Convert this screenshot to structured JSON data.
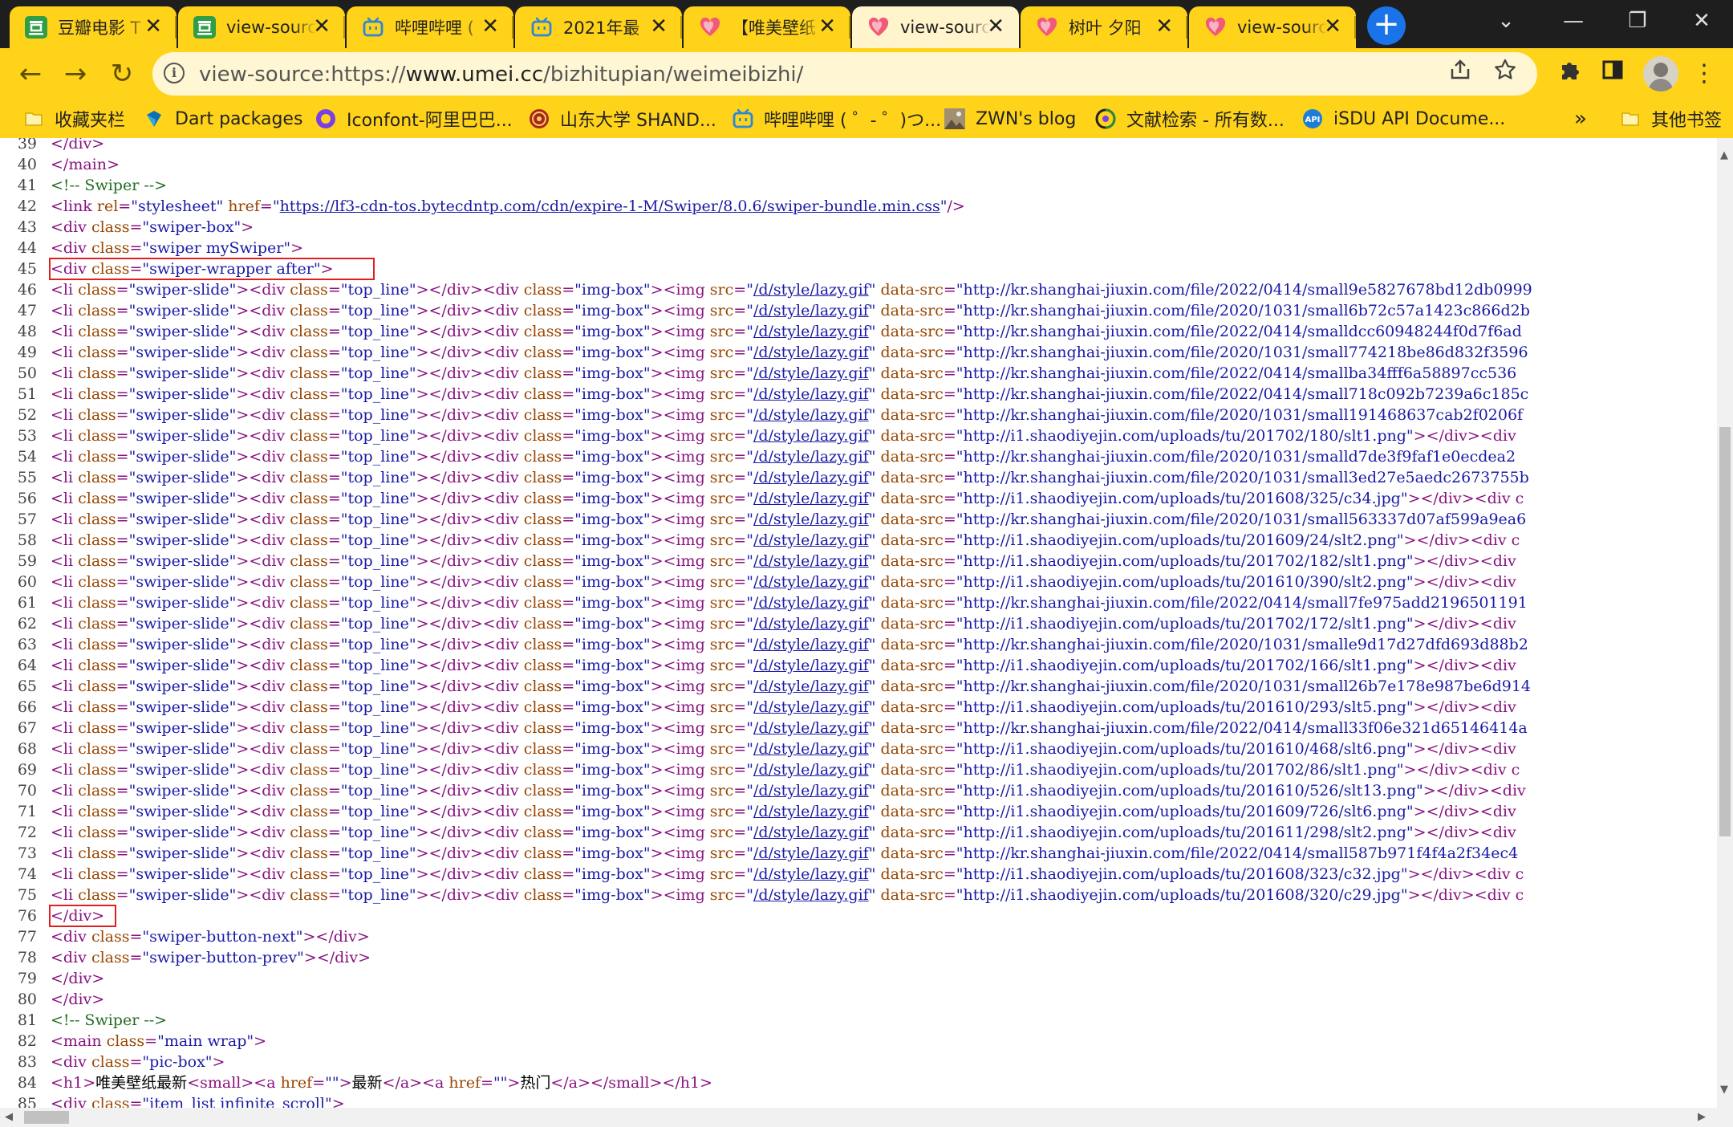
{
  "tabs": [
    {
      "title": "豆瓣电影 T",
      "icon": "douban-icon",
      "active": false
    },
    {
      "title": "view-source",
      "icon": "douban-icon",
      "active": false
    },
    {
      "title": "哔哩哔哩 (",
      "icon": "bilibili-icon",
      "active": false
    },
    {
      "title": "2021年最",
      "icon": "bilibili-icon",
      "active": false
    },
    {
      "title": "【唯美壁纸",
      "icon": "heart-icon",
      "active": false
    },
    {
      "title": "view-source",
      "icon": "heart-icon",
      "active": true
    },
    {
      "title": "树叶 夕阳",
      "icon": "heart-icon",
      "active": false
    },
    {
      "title": "view-source",
      "icon": "heart-icon",
      "active": false
    }
  ],
  "tab_close_glyph": "✕",
  "new_tab_glyph": "+",
  "window_controls": {
    "dropdown": "⌄",
    "minimize": "—",
    "restore": "❐",
    "close": "✕"
  },
  "toolbar": {
    "back": "←",
    "forward": "→",
    "reload": "↻"
  },
  "address": {
    "scheme": "view-source:https://",
    "host": "www.umei.cc",
    "path": "/bizhitupian/weimeibizhi/"
  },
  "bookmarks": [
    {
      "label": "收藏夹栏",
      "icon": "folder-icon"
    },
    {
      "label": "Dart packages",
      "icon": "dart-icon"
    },
    {
      "label": "Iconfont-阿里巴巴...",
      "icon": "iconfont-icon"
    },
    {
      "label": "山东大学 SHAND...",
      "icon": "sdu-icon"
    },
    {
      "label": "哔哩哔哩 ( ゜- ゜)つ...",
      "icon": "bilibili-icon"
    },
    {
      "label": "ZWN's blog",
      "icon": "blog-icon"
    },
    {
      "label": "文献检索 - 所有数...",
      "icon": "literature-icon"
    },
    {
      "label": "iSDU API Docume...",
      "icon": "api-icon"
    }
  ],
  "bookmarks_overflow": "»",
  "other_bookmarks": "其他书签",
  "source_lines": [
    {
      "n": "39",
      "text": "</div>"
    },
    {
      "n": "40",
      "text": "</main>"
    },
    {
      "n": "41",
      "text": "<!-- Swiper -->"
    },
    {
      "n": "42",
      "text": "<link rel=\"stylesheet\" href=\"https://lf3-cdn-tos.bytecdntp.com/cdn/expire-1-M/Swiper/8.0.6/swiper-bundle.min.css\"/>"
    },
    {
      "n": "43",
      "text": "<div class=\"swiper-box\">"
    },
    {
      "n": "44",
      "text": "<div class=\"swiper mySwiper\">"
    },
    {
      "n": "45",
      "text": "<div class=\"swiper-wrapper after\">"
    },
    {
      "n": "46",
      "text": "<li class=\"swiper-slide\"><div class=\"top_line\"></div><div class=\"img-box\"><img src=\"/d/style/lazy.gif\" data-src=\"http://kr.shanghai-jiuxin.com/file/2022/0414/small9e5827678bd12db0999"
    },
    {
      "n": "47",
      "text": "<li class=\"swiper-slide\"><div class=\"top_line\"></div><div class=\"img-box\"><img src=\"/d/style/lazy.gif\" data-src=\"http://kr.shanghai-jiuxin.com/file/2020/1031/small6b72c57a1423c866d2b"
    },
    {
      "n": "48",
      "text": "<li class=\"swiper-slide\"><div class=\"top_line\"></div><div class=\"img-box\"><img src=\"/d/style/lazy.gif\" data-src=\"http://kr.shanghai-jiuxin.com/file/2022/0414/smalldcc60948244f0d7f6ad"
    },
    {
      "n": "49",
      "text": "<li class=\"swiper-slide\"><div class=\"top_line\"></div><div class=\"img-box\"><img src=\"/d/style/lazy.gif\" data-src=\"http://kr.shanghai-jiuxin.com/file/2020/1031/small774218be86d832f3596"
    },
    {
      "n": "50",
      "text": "<li class=\"swiper-slide\"><div class=\"top_line\"></div><div class=\"img-box\"><img src=\"/d/style/lazy.gif\" data-src=\"http://kr.shanghai-jiuxin.com/file/2022/0414/smallba34fff6a58897cc536"
    },
    {
      "n": "51",
      "text": "<li class=\"swiper-slide\"><div class=\"top_line\"></div><div class=\"img-box\"><img src=\"/d/style/lazy.gif\" data-src=\"http://kr.shanghai-jiuxin.com/file/2022/0414/small718c092b7239a6c185c"
    },
    {
      "n": "52",
      "text": "<li class=\"swiper-slide\"><div class=\"top_line\"></div><div class=\"img-box\"><img src=\"/d/style/lazy.gif\" data-src=\"http://kr.shanghai-jiuxin.com/file/2020/1031/small191468637cab2f0206f"
    },
    {
      "n": "53",
      "text": "<li class=\"swiper-slide\"><div class=\"top_line\"></div><div class=\"img-box\"><img src=\"/d/style/lazy.gif\" data-src=\"http://i1.shaodiyejin.com/uploads/tu/201702/180/slt1.png\"></div><div"
    },
    {
      "n": "54",
      "text": "<li class=\"swiper-slide\"><div class=\"top_line\"></div><div class=\"img-box\"><img src=\"/d/style/lazy.gif\" data-src=\"http://kr.shanghai-jiuxin.com/file/2020/1031/smalld7de3f9faf1e0ecdea2"
    },
    {
      "n": "55",
      "text": "<li class=\"swiper-slide\"><div class=\"top_line\"></div><div class=\"img-box\"><img src=\"/d/style/lazy.gif\" data-src=\"http://kr.shanghai-jiuxin.com/file/2020/1031/small3ed27e5aedc2673755b"
    },
    {
      "n": "56",
      "text": "<li class=\"swiper-slide\"><div class=\"top_line\"></div><div class=\"img-box\"><img src=\"/d/style/lazy.gif\" data-src=\"http://i1.shaodiyejin.com/uploads/tu/201608/325/c34.jpg\"></div><div c"
    },
    {
      "n": "57",
      "text": "<li class=\"swiper-slide\"><div class=\"top_line\"></div><div class=\"img-box\"><img src=\"/d/style/lazy.gif\" data-src=\"http://kr.shanghai-jiuxin.com/file/2020/1031/small563337d07af599a9ea6"
    },
    {
      "n": "58",
      "text": "<li class=\"swiper-slide\"><div class=\"top_line\"></div><div class=\"img-box\"><img src=\"/d/style/lazy.gif\" data-src=\"http://i1.shaodiyejin.com/uploads/tu/201609/24/slt2.png\"></div><div c"
    },
    {
      "n": "59",
      "text": "<li class=\"swiper-slide\"><div class=\"top_line\"></div><div class=\"img-box\"><img src=\"/d/style/lazy.gif\" data-src=\"http://i1.shaodiyejin.com/uploads/tu/201702/182/slt1.png\"></div><div"
    },
    {
      "n": "60",
      "text": "<li class=\"swiper-slide\"><div class=\"top_line\"></div><div class=\"img-box\"><img src=\"/d/style/lazy.gif\" data-src=\"http://i1.shaodiyejin.com/uploads/tu/201610/390/slt2.png\"></div><div"
    },
    {
      "n": "61",
      "text": "<li class=\"swiper-slide\"><div class=\"top_line\"></div><div class=\"img-box\"><img src=\"/d/style/lazy.gif\" data-src=\"http://kr.shanghai-jiuxin.com/file/2022/0414/small7fe975add2196501191"
    },
    {
      "n": "62",
      "text": "<li class=\"swiper-slide\"><div class=\"top_line\"></div><div class=\"img-box\"><img src=\"/d/style/lazy.gif\" data-src=\"http://i1.shaodiyejin.com/uploads/tu/201702/172/slt1.png\"></div><div"
    },
    {
      "n": "63",
      "text": "<li class=\"swiper-slide\"><div class=\"top_line\"></div><div class=\"img-box\"><img src=\"/d/style/lazy.gif\" data-src=\"http://kr.shanghai-jiuxin.com/file/2020/1031/smalle9d17d27dfd693d88b2"
    },
    {
      "n": "64",
      "text": "<li class=\"swiper-slide\"><div class=\"top_line\"></div><div class=\"img-box\"><img src=\"/d/style/lazy.gif\" data-src=\"http://i1.shaodiyejin.com/uploads/tu/201702/166/slt1.png\"></div><div"
    },
    {
      "n": "65",
      "text": "<li class=\"swiper-slide\"><div class=\"top_line\"></div><div class=\"img-box\"><img src=\"/d/style/lazy.gif\" data-src=\"http://kr.shanghai-jiuxin.com/file/2020/1031/small26b7e178e987be6d914"
    },
    {
      "n": "66",
      "text": "<li class=\"swiper-slide\"><div class=\"top_line\"></div><div class=\"img-box\"><img src=\"/d/style/lazy.gif\" data-src=\"http://i1.shaodiyejin.com/uploads/tu/201610/293/slt5.png\"></div><div"
    },
    {
      "n": "67",
      "text": "<li class=\"swiper-slide\"><div class=\"top_line\"></div><div class=\"img-box\"><img src=\"/d/style/lazy.gif\" data-src=\"http://kr.shanghai-jiuxin.com/file/2022/0414/small33f06e321d65146414a"
    },
    {
      "n": "68",
      "text": "<li class=\"swiper-slide\"><div class=\"top_line\"></div><div class=\"img-box\"><img src=\"/d/style/lazy.gif\" data-src=\"http://i1.shaodiyejin.com/uploads/tu/201610/468/slt6.png\"></div><div"
    },
    {
      "n": "69",
      "text": "<li class=\"swiper-slide\"><div class=\"top_line\"></div><div class=\"img-box\"><img src=\"/d/style/lazy.gif\" data-src=\"http://i1.shaodiyejin.com/uploads/tu/201702/86/slt1.png\"></div><div c"
    },
    {
      "n": "70",
      "text": "<li class=\"swiper-slide\"><div class=\"top_line\"></div><div class=\"img-box\"><img src=\"/d/style/lazy.gif\" data-src=\"http://i1.shaodiyejin.com/uploads/tu/201610/526/slt13.png\"></div><div"
    },
    {
      "n": "71",
      "text": "<li class=\"swiper-slide\"><div class=\"top_line\"></div><div class=\"img-box\"><img src=\"/d/style/lazy.gif\" data-src=\"http://i1.shaodiyejin.com/uploads/tu/201609/726/slt6.png\"></div><div"
    },
    {
      "n": "72",
      "text": "<li class=\"swiper-slide\"><div class=\"top_line\"></div><div class=\"img-box\"><img src=\"/d/style/lazy.gif\" data-src=\"http://i1.shaodiyejin.com/uploads/tu/201611/298/slt2.png\"></div><div"
    },
    {
      "n": "73",
      "text": "<li class=\"swiper-slide\"><div class=\"top_line\"></div><div class=\"img-box\"><img src=\"/d/style/lazy.gif\" data-src=\"http://kr.shanghai-jiuxin.com/file/2022/0414/small587b971f4f4a2f34ec4"
    },
    {
      "n": "74",
      "text": "<li class=\"swiper-slide\"><div class=\"top_line\"></div><div class=\"img-box\"><img src=\"/d/style/lazy.gif\" data-src=\"http://i1.shaodiyejin.com/uploads/tu/201608/323/c32.jpg\"></div><div c"
    },
    {
      "n": "75",
      "text": "<li class=\"swiper-slide\"><div class=\"top_line\"></div><div class=\"img-box\"><img src=\"/d/style/lazy.gif\" data-src=\"http://i1.shaodiyejin.com/uploads/tu/201608/320/c29.jpg\"></div><div c"
    },
    {
      "n": "76",
      "text": "</div>"
    },
    {
      "n": "77",
      "text": "<div class=\"swiper-button-next\"></div>"
    },
    {
      "n": "78",
      "text": "<div class=\"swiper-button-prev\"></div>"
    },
    {
      "n": "79",
      "text": "</div>"
    },
    {
      "n": "80",
      "text": "</div>"
    },
    {
      "n": "81",
      "text": "<!-- Swiper -->"
    },
    {
      "n": "82",
      "text": "<main class=\"main wrap\">"
    },
    {
      "n": "83",
      "text": "<div class=\"pic-box\">"
    },
    {
      "n": "84",
      "text": "<h1>唯美壁纸最新<small><a href=\"\">最新</a><a href=\"\">热门</a></small></h1>"
    },
    {
      "n": "85",
      "text": "<div class=\"item_list infinite_scroll\">"
    }
  ],
  "highlighted_lines": [
    "45",
    "76"
  ],
  "scrollbar": {
    "up": "▲",
    "down": "▼",
    "left": "◀",
    "right": "▶"
  }
}
